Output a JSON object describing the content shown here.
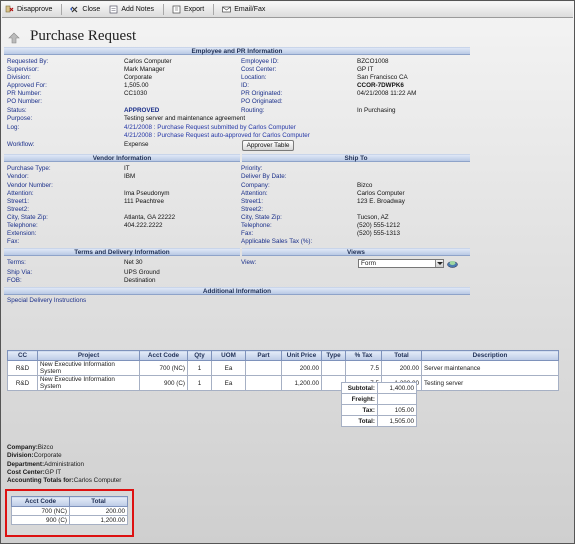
{
  "toolbar": {
    "disapprove": "Disapprove",
    "close": "Close",
    "add_notes": "Add Notes",
    "export": "Export",
    "email_fax": "Email/Fax"
  },
  "page_title": "Purchase Request",
  "sections": {
    "employee": "Employee and PR Information",
    "vendor": "Vendor Information",
    "ship_to": "Ship To",
    "terms": "Terms and Delivery Information",
    "views": "Views",
    "additional": "Additional Information"
  },
  "employee": {
    "requested_by_label": "Requested By:",
    "requested_by": "Carlos Computer",
    "supervisor_label": "Supervisor:",
    "supervisor": "Mark Manager",
    "division_label": "Division:",
    "division": "Corporate",
    "approved_for_label": "Approved For:",
    "approved_for": "1,505.00",
    "pr_number_label": "PR Number:",
    "pr_number": "CC1030",
    "po_number_label": "PO Number:",
    "po_number": "",
    "status_label": "Status:",
    "status": "APPROVED",
    "purpose_label": "Purpose:",
    "purpose": "Testing server and maintenance agreement",
    "log_label": "Log:",
    "log1": "4/21/2008 : Purchase Request submitted by Carlos Computer",
    "log2": "4/21/2008 : Purchase Request auto-approved for Carlos Computer",
    "workflow_label": "Workflow:",
    "workflow": "Expense",
    "approver_table": "Approver Table",
    "employee_id_label": "Employee ID:",
    "employee_id": "BZCO1008",
    "cost_center_label": "Cost Center:",
    "cost_center": "GP IT",
    "location_label": "Location:",
    "location": "San Francisco CA",
    "id_label": "ID:",
    "id": "CCOR-7DWPK6",
    "pr_originated_label": "PR Originated:",
    "pr_originated": "04/21/2008 11:22 AM",
    "po_originated_label": "PO Originated:",
    "po_originated": "",
    "routing_label": "Routing:",
    "routing": "In Purchasing"
  },
  "vendor": {
    "purchase_type_label": "Purchase Type:",
    "purchase_type": "IT",
    "vendor_label": "Vendor:",
    "vendor": "IBM",
    "vendor_number_label": "Vendor Number:",
    "vendor_number": "",
    "attention_label": "Attention:",
    "attention": "Ima Pseudonym",
    "street1_label": "Street1:",
    "street1": "111 Peachtree",
    "street2_label": "Street2:",
    "street2": "",
    "city_label": "City, State Zip:",
    "city": "Atlanta, GA 22222",
    "telephone_label": "Telephone:",
    "telephone": "404.222.2222",
    "extension_label": "Extension:",
    "extension": "",
    "fax_label": "Fax:",
    "fax": ""
  },
  "ship_to": {
    "priority_label": "Priority:",
    "priority": "",
    "deliver_by_label": "Deliver By Date:",
    "deliver_by": "",
    "company_label": "Company:",
    "company": "Bizco",
    "attention_label": "Attention:",
    "attention": "Carlos Computer",
    "street1_label": "Street1:",
    "street1": "123 E. Broadway",
    "street2_label": "Street2:",
    "street2": "",
    "city_label": "City, State Zip:",
    "city": "Tucson, AZ",
    "telephone_label": "Telephone:",
    "telephone": "(520) 555-1212",
    "fax_label": "Fax:",
    "fax": "(520) 555-1313",
    "tax_label": "Applicable Sales Tax (%):",
    "tax": ""
  },
  "terms": {
    "terms_label": "Terms:",
    "terms": "Net 30",
    "ship_via_label": "Ship Via:",
    "ship_via": "UPS Ground",
    "fob_label": "FOB:",
    "fob": "Destination",
    "view_label": "View:",
    "view_value": "Form"
  },
  "additional": {
    "special_delivery": "Special Delivery Instructions"
  },
  "line_items": {
    "headers": [
      "CC",
      "Project",
      "Acct Code",
      "Qty",
      "UOM",
      "Part",
      "Unit Price",
      "Type",
      "% Tax",
      "Total",
      "Description"
    ],
    "rows": [
      [
        "R&D",
        "New Executive Information System",
        "700 (NC)",
        "1",
        "Ea",
        "",
        "200.00",
        "",
        "7.5",
        "200.00",
        "Server maintenance"
      ],
      [
        "R&D",
        "New Executive Information System",
        "900 (C)",
        "1",
        "Ea",
        "",
        "1,200.00",
        "",
        "7.5",
        "1,200.00",
        "Testing server"
      ]
    ],
    "subtotal_label": "Subtotal:",
    "subtotal": "1,400.00",
    "freight_label": "Freight:",
    "freight": "",
    "tax_label": "Tax:",
    "tax": "105.00",
    "total_label": "Total:",
    "total": "1,505.00"
  },
  "summary": {
    "company_label": "Company:",
    "company": "Bizco",
    "division_label": "Division:",
    "division": "Corporate",
    "department_label": "Department:",
    "department": "Administration",
    "cost_center_label": "Cost Center:",
    "cost_center": "GP IT",
    "accounting_label": "Accounting Totals for:",
    "accounting": "Carlos Computer"
  },
  "acct_totals": {
    "headers": [
      "Acct Code",
      "Total"
    ],
    "rows": [
      [
        "700 (NC)",
        "200.00"
      ],
      [
        "900 (C)",
        "1,200.00"
      ]
    ]
  }
}
